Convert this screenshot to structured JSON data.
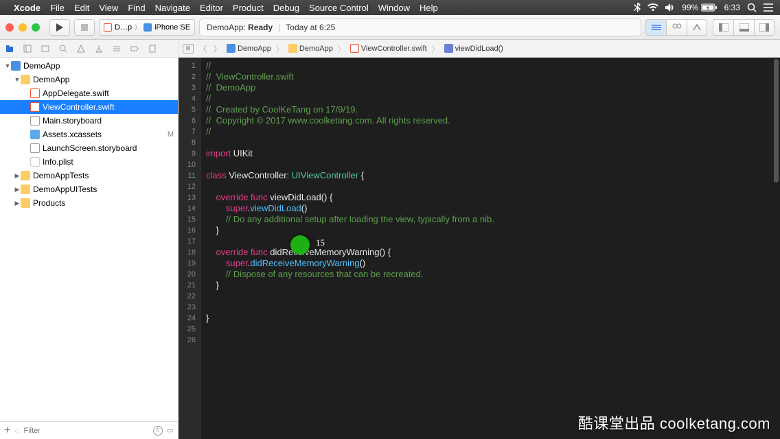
{
  "menubar": {
    "app": "Xcode",
    "items": [
      "File",
      "Edit",
      "View",
      "Find",
      "Navigate",
      "Editor",
      "Product",
      "Debug",
      "Source Control",
      "Window",
      "Help"
    ],
    "battery": "99%",
    "time": "6:33"
  },
  "toolbar": {
    "scheme_target": "D…p",
    "scheme_device": "iPhone SE",
    "status_title": "DemoApp:",
    "status_state": "Ready",
    "status_time": "Today at 6:25"
  },
  "jumpbar": {
    "items": [
      "DemoApp",
      "DemoApp",
      "ViewController.swift",
      "viewDidLoad()"
    ]
  },
  "tree": [
    {
      "depth": 0,
      "disc": "▼",
      "icon": "fi-proj",
      "label": "DemoApp"
    },
    {
      "depth": 1,
      "disc": "▼",
      "icon": "fi-folder",
      "label": "DemoApp"
    },
    {
      "depth": 2,
      "disc": "",
      "icon": "fi-swift",
      "label": "AppDelegate.swift"
    },
    {
      "depth": 2,
      "disc": "",
      "icon": "fi-swift",
      "label": "ViewController.swift",
      "selected": true
    },
    {
      "depth": 2,
      "disc": "",
      "icon": "fi-story",
      "label": "Main.storyboard"
    },
    {
      "depth": 2,
      "disc": "",
      "icon": "fi-assets",
      "label": "Assets.xcassets",
      "mod": "M"
    },
    {
      "depth": 2,
      "disc": "",
      "icon": "fi-story",
      "label": "LaunchScreen.storyboard"
    },
    {
      "depth": 2,
      "disc": "",
      "icon": "fi-plist",
      "label": "Info.plist"
    },
    {
      "depth": 1,
      "disc": "▶",
      "icon": "fi-folder",
      "label": "DemoAppTests"
    },
    {
      "depth": 1,
      "disc": "▶",
      "icon": "fi-folder",
      "label": "DemoAppUITests"
    },
    {
      "depth": 1,
      "disc": "▶",
      "icon": "fi-folder",
      "label": "Products"
    }
  ],
  "filter_placeholder": "Filter",
  "code": {
    "lines": [
      [
        {
          "c": "c-comment",
          "t": "//"
        }
      ],
      [
        {
          "c": "c-comment",
          "t": "//  ViewController.swift"
        }
      ],
      [
        {
          "c": "c-comment",
          "t": "//  DemoApp"
        }
      ],
      [
        {
          "c": "c-comment",
          "t": "//"
        }
      ],
      [
        {
          "c": "c-comment",
          "t": "//  Created by CoolKeTang on 17/9/19."
        }
      ],
      [
        {
          "c": "c-comment",
          "t": "//  Copyright © 2017 www.coolketang.com. All rights reserved."
        }
      ],
      [
        {
          "c": "c-comment",
          "t": "//"
        }
      ],
      [],
      [
        {
          "c": "c-kw",
          "t": "import"
        },
        {
          "c": "c-plain",
          "t": " UIKit"
        }
      ],
      [],
      [
        {
          "c": "c-kw",
          "t": "class"
        },
        {
          "c": "c-plain",
          "t": " ViewController: "
        },
        {
          "c": "c-type",
          "t": "UIViewController"
        },
        {
          "c": "c-plain",
          "t": " {"
        }
      ],
      [],
      [
        {
          "c": "c-plain",
          "t": "    "
        },
        {
          "c": "c-kw",
          "t": "override"
        },
        {
          "c": "c-plain",
          "t": " "
        },
        {
          "c": "c-kw",
          "t": "func"
        },
        {
          "c": "c-plain",
          "t": " viewDidLoad() {"
        }
      ],
      [
        {
          "c": "c-plain",
          "t": "        "
        },
        {
          "c": "c-kw",
          "t": "super"
        },
        {
          "c": "c-plain",
          "t": "."
        },
        {
          "c": "c-func",
          "t": "viewDidLoad"
        },
        {
          "c": "c-plain",
          "t": "()"
        }
      ],
      [
        {
          "c": "c-plain",
          "t": "        "
        },
        {
          "c": "c-comment",
          "t": "// Do any additional setup after loading the view, typically from a nib."
        }
      ],
      [
        {
          "c": "c-plain",
          "t": "    }"
        }
      ],
      [],
      [
        {
          "c": "c-plain",
          "t": "    "
        },
        {
          "c": "c-kw",
          "t": "override"
        },
        {
          "c": "c-plain",
          "t": " "
        },
        {
          "c": "c-kw",
          "t": "func"
        },
        {
          "c": "c-plain",
          "t": " didReceiveMemoryWarning() {"
        }
      ],
      [
        {
          "c": "c-plain",
          "t": "        "
        },
        {
          "c": "c-kw",
          "t": "super"
        },
        {
          "c": "c-plain",
          "t": "."
        },
        {
          "c": "c-func",
          "t": "didReceiveMemoryWarning"
        },
        {
          "c": "c-plain",
          "t": "()"
        }
      ],
      [
        {
          "c": "c-plain",
          "t": "        "
        },
        {
          "c": "c-comment",
          "t": "// Dispose of any resources that can be recreated."
        }
      ],
      [
        {
          "c": "c-plain",
          "t": "    }"
        }
      ],
      [],
      [],
      [
        {
          "c": "c-plain",
          "t": "}"
        }
      ],
      [],
      []
    ]
  },
  "cursor_hint": "15",
  "watermark": "酷课堂出品 coolketang.com"
}
